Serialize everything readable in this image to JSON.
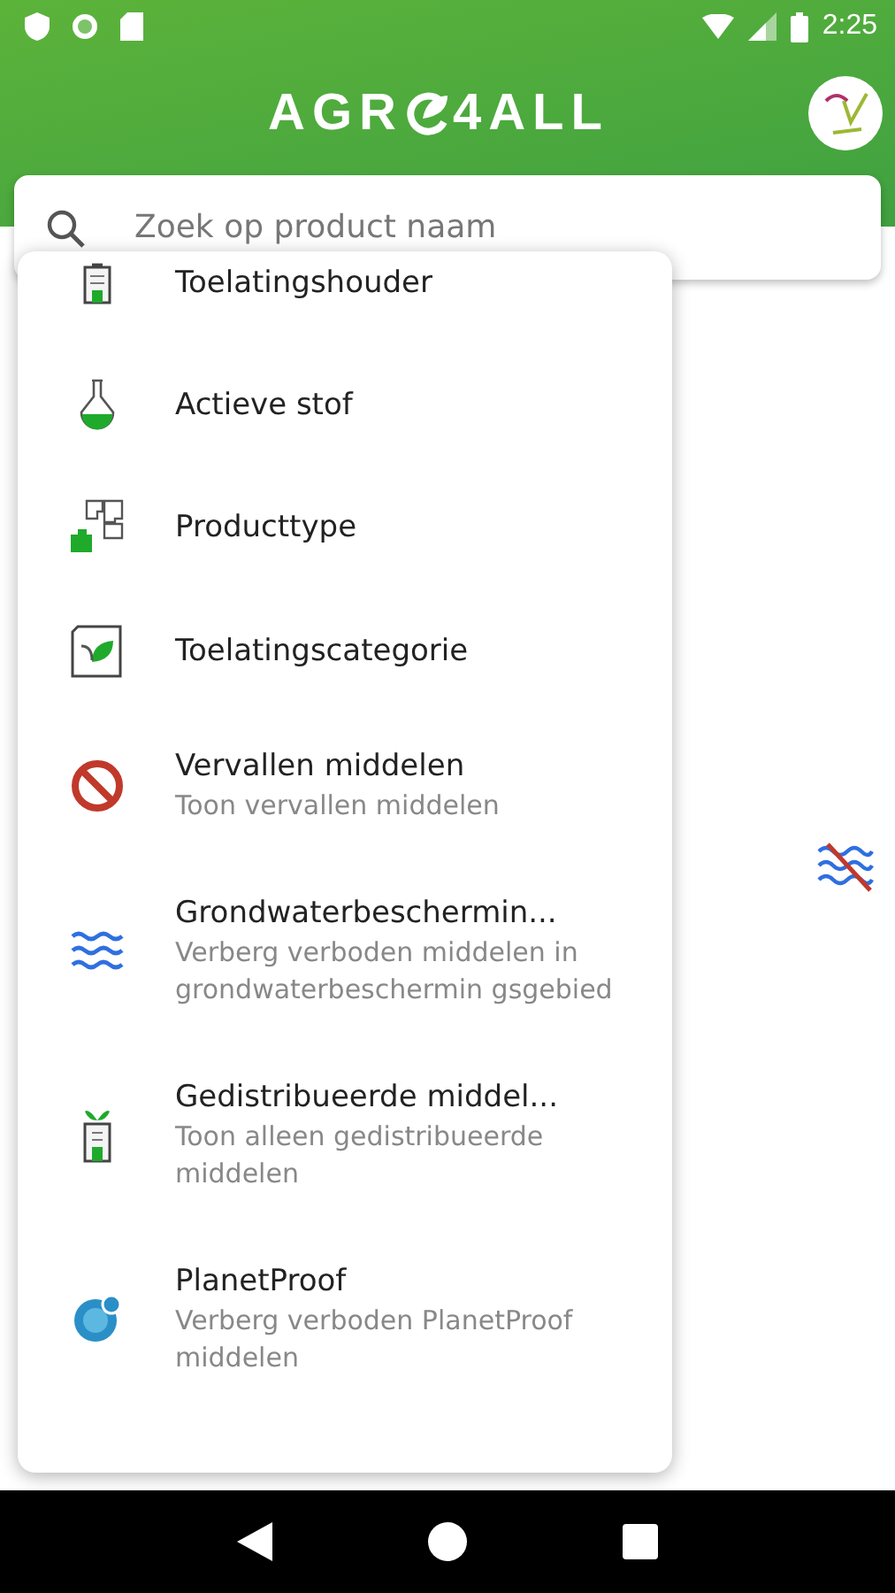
{
  "status_bar": {
    "time": "2:25"
  },
  "header": {
    "logo_start": "AGR",
    "logo_end": "4ALL"
  },
  "search": {
    "placeholder": "Zoek op product naam"
  },
  "menu": [
    {
      "title": "Toelatingshouder"
    },
    {
      "title": "Actieve stof"
    },
    {
      "title": "Producttype"
    },
    {
      "title": "Toelatingscategorie"
    },
    {
      "title": "Vervallen middelen",
      "subtitle": "Toon vervallen middelen"
    },
    {
      "title": "Grondwaterbeschermin...",
      "subtitle": "Verberg verboden middelen in grondwaterbeschermin gsgebied"
    },
    {
      "title": "Gedistribueerde middel...",
      "subtitle": "Toon alleen gedistribueerde middelen"
    },
    {
      "title": "PlanetProof",
      "subtitle": "Verberg verboden PlanetProof middelen"
    }
  ]
}
